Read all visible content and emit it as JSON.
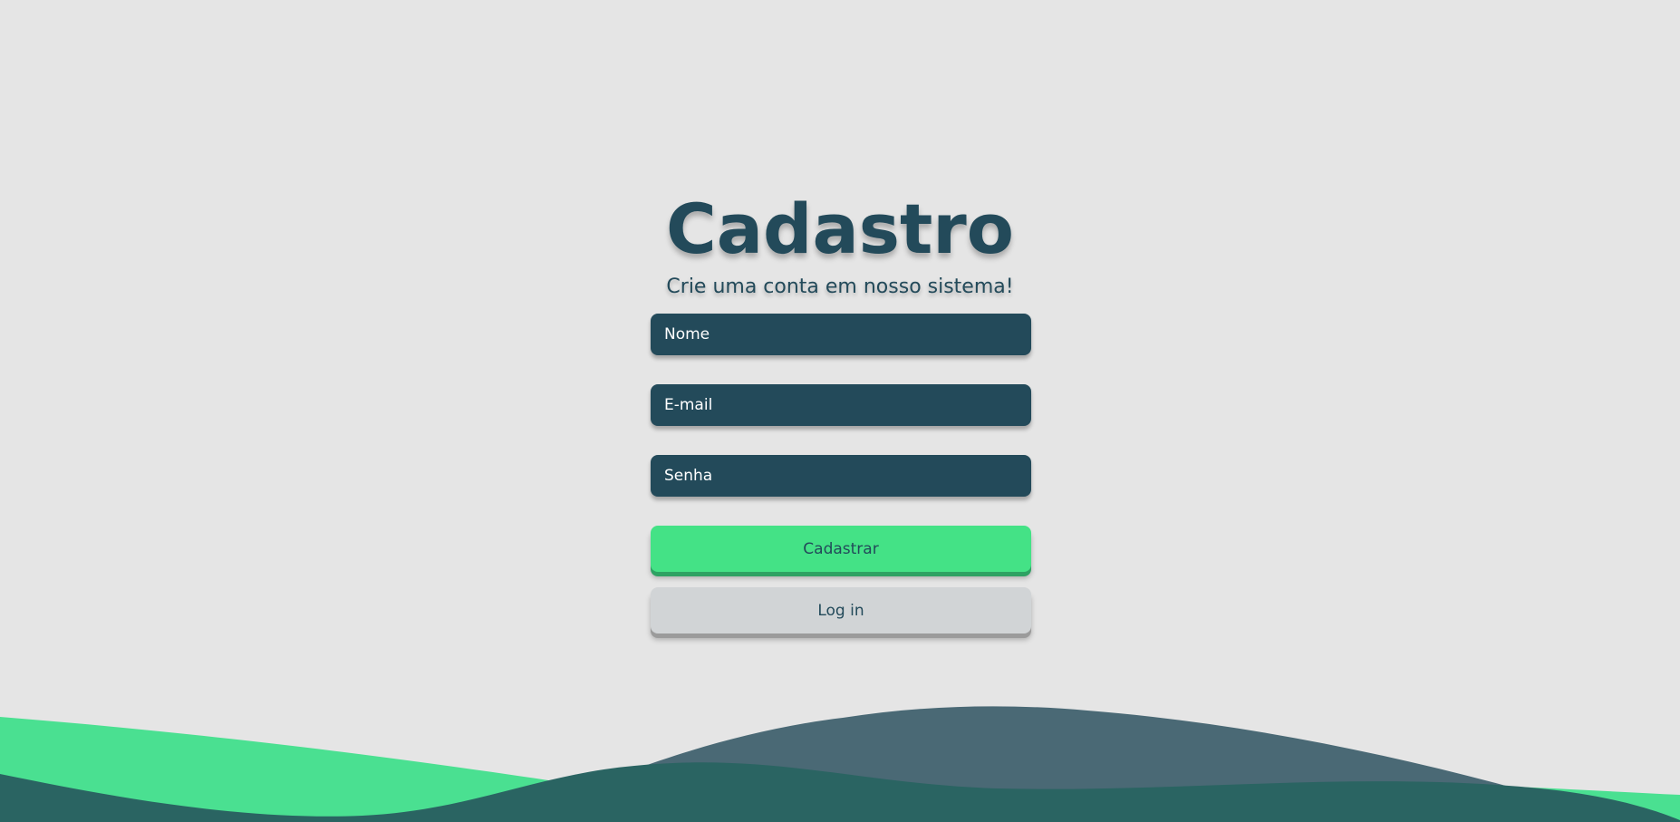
{
  "page": {
    "title": "Cadastro",
    "subtitle": "Crie uma conta em nosso sistema!"
  },
  "form": {
    "name_placeholder": "Nome",
    "email_placeholder": "E-mail",
    "password_placeholder": "Senha",
    "register_label": "Cadastrar",
    "login_label": "Log in"
  },
  "colors": {
    "background": "#e5e5e5",
    "primary_dark": "#234a5a",
    "accent_green": "#44e286",
    "secondary_button": "#d1d4d6",
    "wave_slate": "#4a6975",
    "wave_teal": "#2a6462"
  }
}
